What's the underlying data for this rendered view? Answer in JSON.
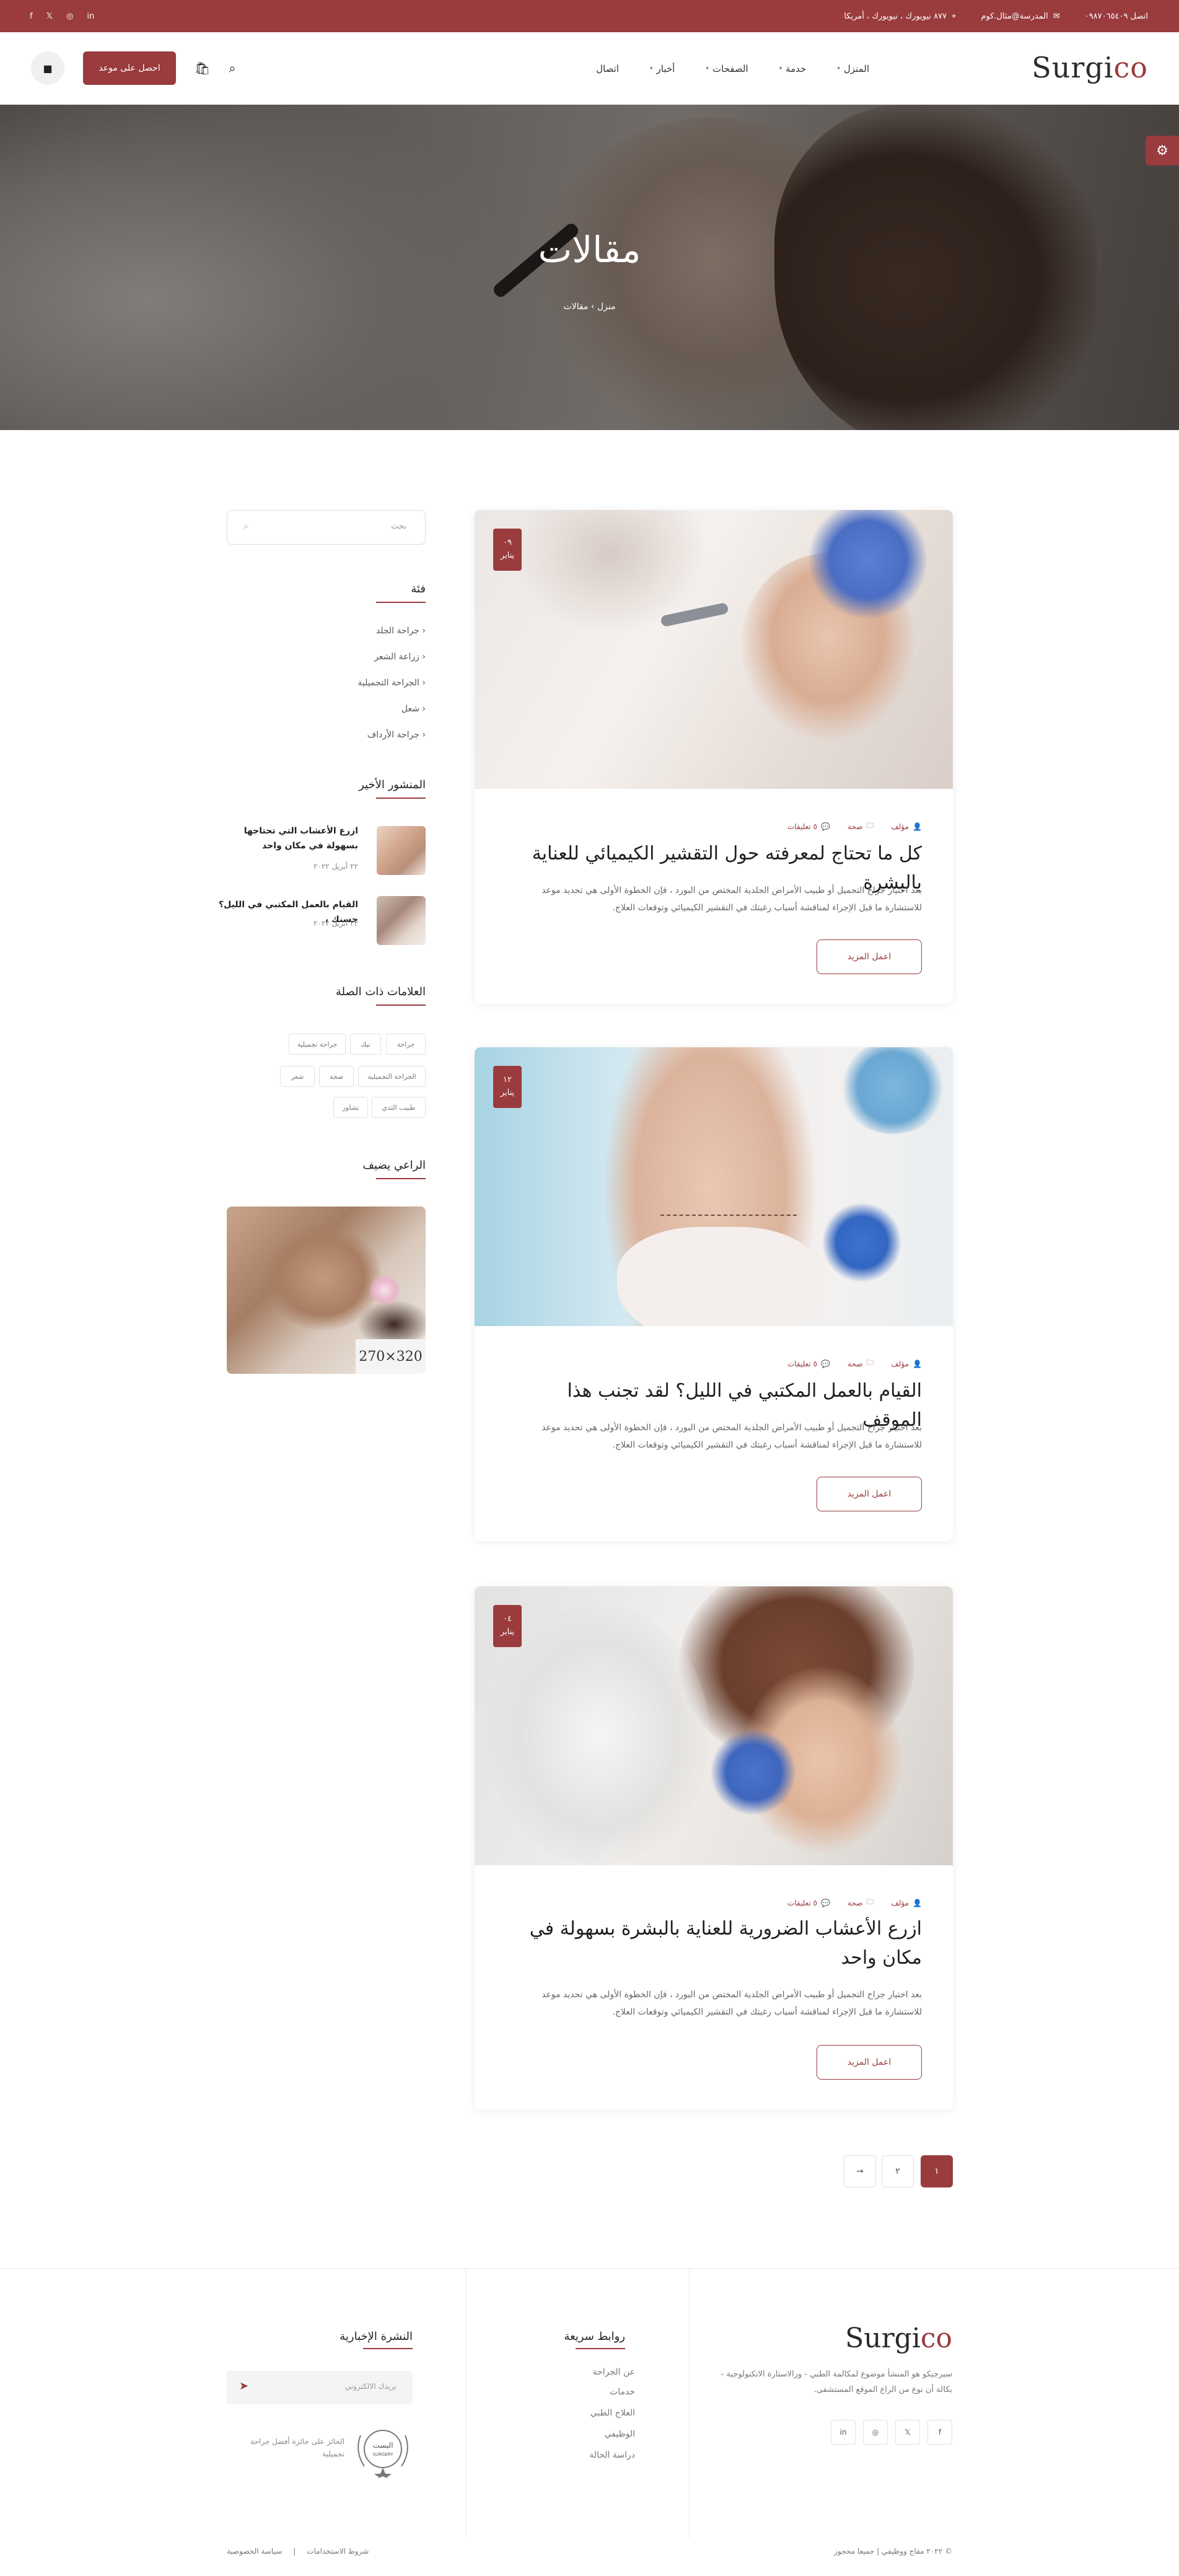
{
  "topbar": {
    "phone": "اتصل ٠٩٨٧٠٦٥٤٠٩",
    "email": "المدرسة@مثال.كوم",
    "address": "٨٧٧ نيويورك ، نيويورك ، أمريكا",
    "social": [
      "in",
      "◎",
      "𝕏",
      "f"
    ]
  },
  "header": {
    "logo_main": "Surgi",
    "logo_accent": "co",
    "nav": [
      "المنزل",
      "خدمة",
      "الصفحات",
      "أخبار",
      "اتصال"
    ],
    "appointment_btn": "احصل على موعد"
  },
  "hero": {
    "title": "مقالات",
    "crumb_home": "منزل",
    "crumb_current": "مقالات"
  },
  "posts": [
    {
      "day": "٠٩",
      "month": "يناير",
      "author": "مؤلف",
      "category": "صحة",
      "comments": "٥ تعليقات",
      "title": "كل ما تحتاج لمعرفته حول التقشير الكيميائي للعناية بالبشرة",
      "excerpt": "بعد اختيار جراح التجميل أو طبيب الأمراض الجلدية المختص من البورد ، فإن الخطوة الأولى هي تحديد موعد للاستشارة ما قبل الإجراء لمناقشة أسباب رغبتك في التقشير الكيميائي وتوقعات العلاج.",
      "more": "اعمل المزيد"
    },
    {
      "day": "١٢",
      "month": "يناير",
      "author": "مؤلف",
      "category": "صحة",
      "comments": "٥ تعليقات",
      "title": "القيام بالعمل المكتبي في الليل؟ لقد تجنب هذا الموقف",
      "excerpt": "بعد اختيار جراح التجميل أو طبيب الأمراض الجلدية المختص من البورد ، فإن الخطوة الأولى هي تحديد موعد للاستشارة ما قبل الإجراء لمناقشة أسباب رغبتك في التقشير الكيميائي وتوقعات العلاج.",
      "more": "اعمل المزيد"
    },
    {
      "day": "٠٤",
      "month": "يناير",
      "author": "مؤلف",
      "category": "صحة",
      "comments": "٥ تعليقات",
      "title": "ازرع الأعشاب الضرورية للعناية بالبشرة بسهولة في مكان واحد",
      "excerpt": "بعد اختيار جراح التجميل أو طبيب الأمراض الجلدية المختص من البورد ، فإن الخطوة الأولى هي تحديد موعد للاستشارة ما قبل الإجراء لمناقشة أسباب رغبتك في التقشير الكيميائي وتوقعات العلاج.",
      "more": "اعمل المزيد"
    }
  ],
  "sidebar": {
    "search_placeholder": "بحث",
    "categories_title": "فئة",
    "categories": [
      "جراحة الجلد",
      "زراعة الشعر",
      "الجراحة التجميلية",
      "شعل",
      "جراحة الأرداف"
    ],
    "recent_title": "المنشور الأخير",
    "recent": [
      {
        "title": "ازرع الأعشاب التي تحتاجها بسهولة في مكان واحد",
        "date": "٢٢ أبريل ٢٠٢٢"
      },
      {
        "title": "القيام بالعمل المكتبي في الليل؟ حسنك ،",
        "date": "٢٢ أبريل ٢٠٢٢"
      }
    ],
    "tags_title": "العلامات ذات الصلة",
    "tags": [
      "جراحة",
      "نيك",
      "جراحة تجميلية",
      "الجراحة التجميلية",
      "صحة",
      "شعر",
      "طبيب الثدي",
      "تشاور"
    ],
    "ad_title": "الراعي يضيف",
    "ad_label": "320×270"
  },
  "pagination": [
    "١",
    "٢",
    "→"
  ],
  "footer": {
    "logo_main": "Surgi",
    "logo_accent": "co",
    "desc": "سيرجيكو هو المنشأ موضوع لمكالمة الطبي - ورالاستارة الاتكنولوجية - بكالة أن نوع من الراع الموقع المستشفى.",
    "social": [
      "f",
      "𝕏",
      "◎",
      "in"
    ],
    "links_title": "روابط سريعة",
    "links": [
      "عن الجراحة",
      "خدمات",
      "العلاج الطبي",
      "الوظيفي",
      "دراسة الحالة"
    ],
    "newsletter_title": "النشرة الإخبارية",
    "newsletter_placeholder": "بريدك الالكتروني",
    "badge_text": "البست",
    "badge_sub": "SURGERY",
    "award_text": "الحائز على جائزة أفضل جراحة تجميلية",
    "copyright": "© ٢٠٢٢ مقاج ووظيفي | جميعا محجوز",
    "privacy": "سياسة الخصوصية",
    "terms": "شروط الاستخدامات"
  }
}
